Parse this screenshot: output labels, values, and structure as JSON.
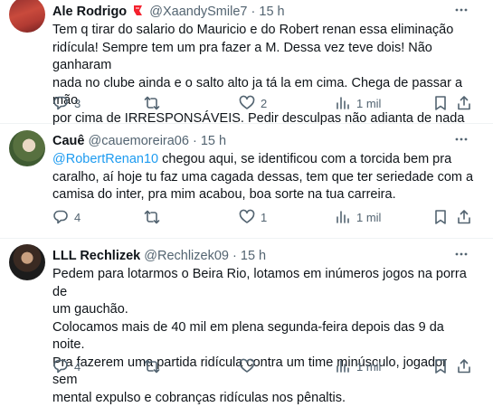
{
  "tweets": [
    {
      "author_name": "Ale Rodrigo",
      "handle": "@XaandySmile7",
      "separator": "·",
      "time": "15 h",
      "text_lines": [
        "Tem q tirar do salario do Mauricio e do Robert renan essa eliminação",
        "ridícula! Sempre tem um pra fazer a M. Dessa vez teve dois! Não ganharam",
        "nada no clube ainda e o salto alto ja tá la em cima. Chega de passar a mão",
        "por cima de IRRESPONSÁVEIS. Pedir desculpas não adianta de nada"
      ],
      "replies": "3",
      "retweets": "",
      "likes": "2",
      "views": "1 mil"
    },
    {
      "author_name": "Cauê",
      "handle": "@cauemoreira06",
      "separator": "·",
      "time": "15 h",
      "mention": "@RobertRenan10",
      "text_lines": [
        " chegou aqui, se identificou com a torcida bem pra",
        "caralho, aí hoje tu faz uma cagada dessas, tem que ter seriedade com a",
        "camisa do inter, pra mim acabou, boa sorte na tua carreira."
      ],
      "replies": "4",
      "retweets": "",
      "likes": "1",
      "views": "1 mil"
    },
    {
      "author_name": "LLL Rechlizek",
      "handle": "@Rechlizek09",
      "separator": "·",
      "time": "15 h",
      "text_lines": [
        "Pedem para lotarmos o Beira Rio, lotamos em inúmeros jogos na porra de",
        "um gauchão.",
        "Colocamos mais de 40 mil em plena segunda-feira depois das 9 da noite.",
        "Pra fazerem uma partida ridícula contra um time minúsculo, jogador sem",
        "mental expulso e cobranças ridículas nos pênaltis."
      ],
      "replies": "4",
      "retweets": "",
      "likes": "",
      "views": "1 mil"
    }
  ],
  "colors": {
    "text": "#0f1419",
    "secondary": "#536471",
    "link": "#1d9bf0",
    "badge": "#f4212e",
    "divider": "#eff3f4"
  },
  "icons": [
    "reply-icon",
    "retweet-icon",
    "like-icon",
    "views-icon",
    "bookmark-icon",
    "share-icon",
    "more-icon",
    "affiliate-badge-icon"
  ]
}
